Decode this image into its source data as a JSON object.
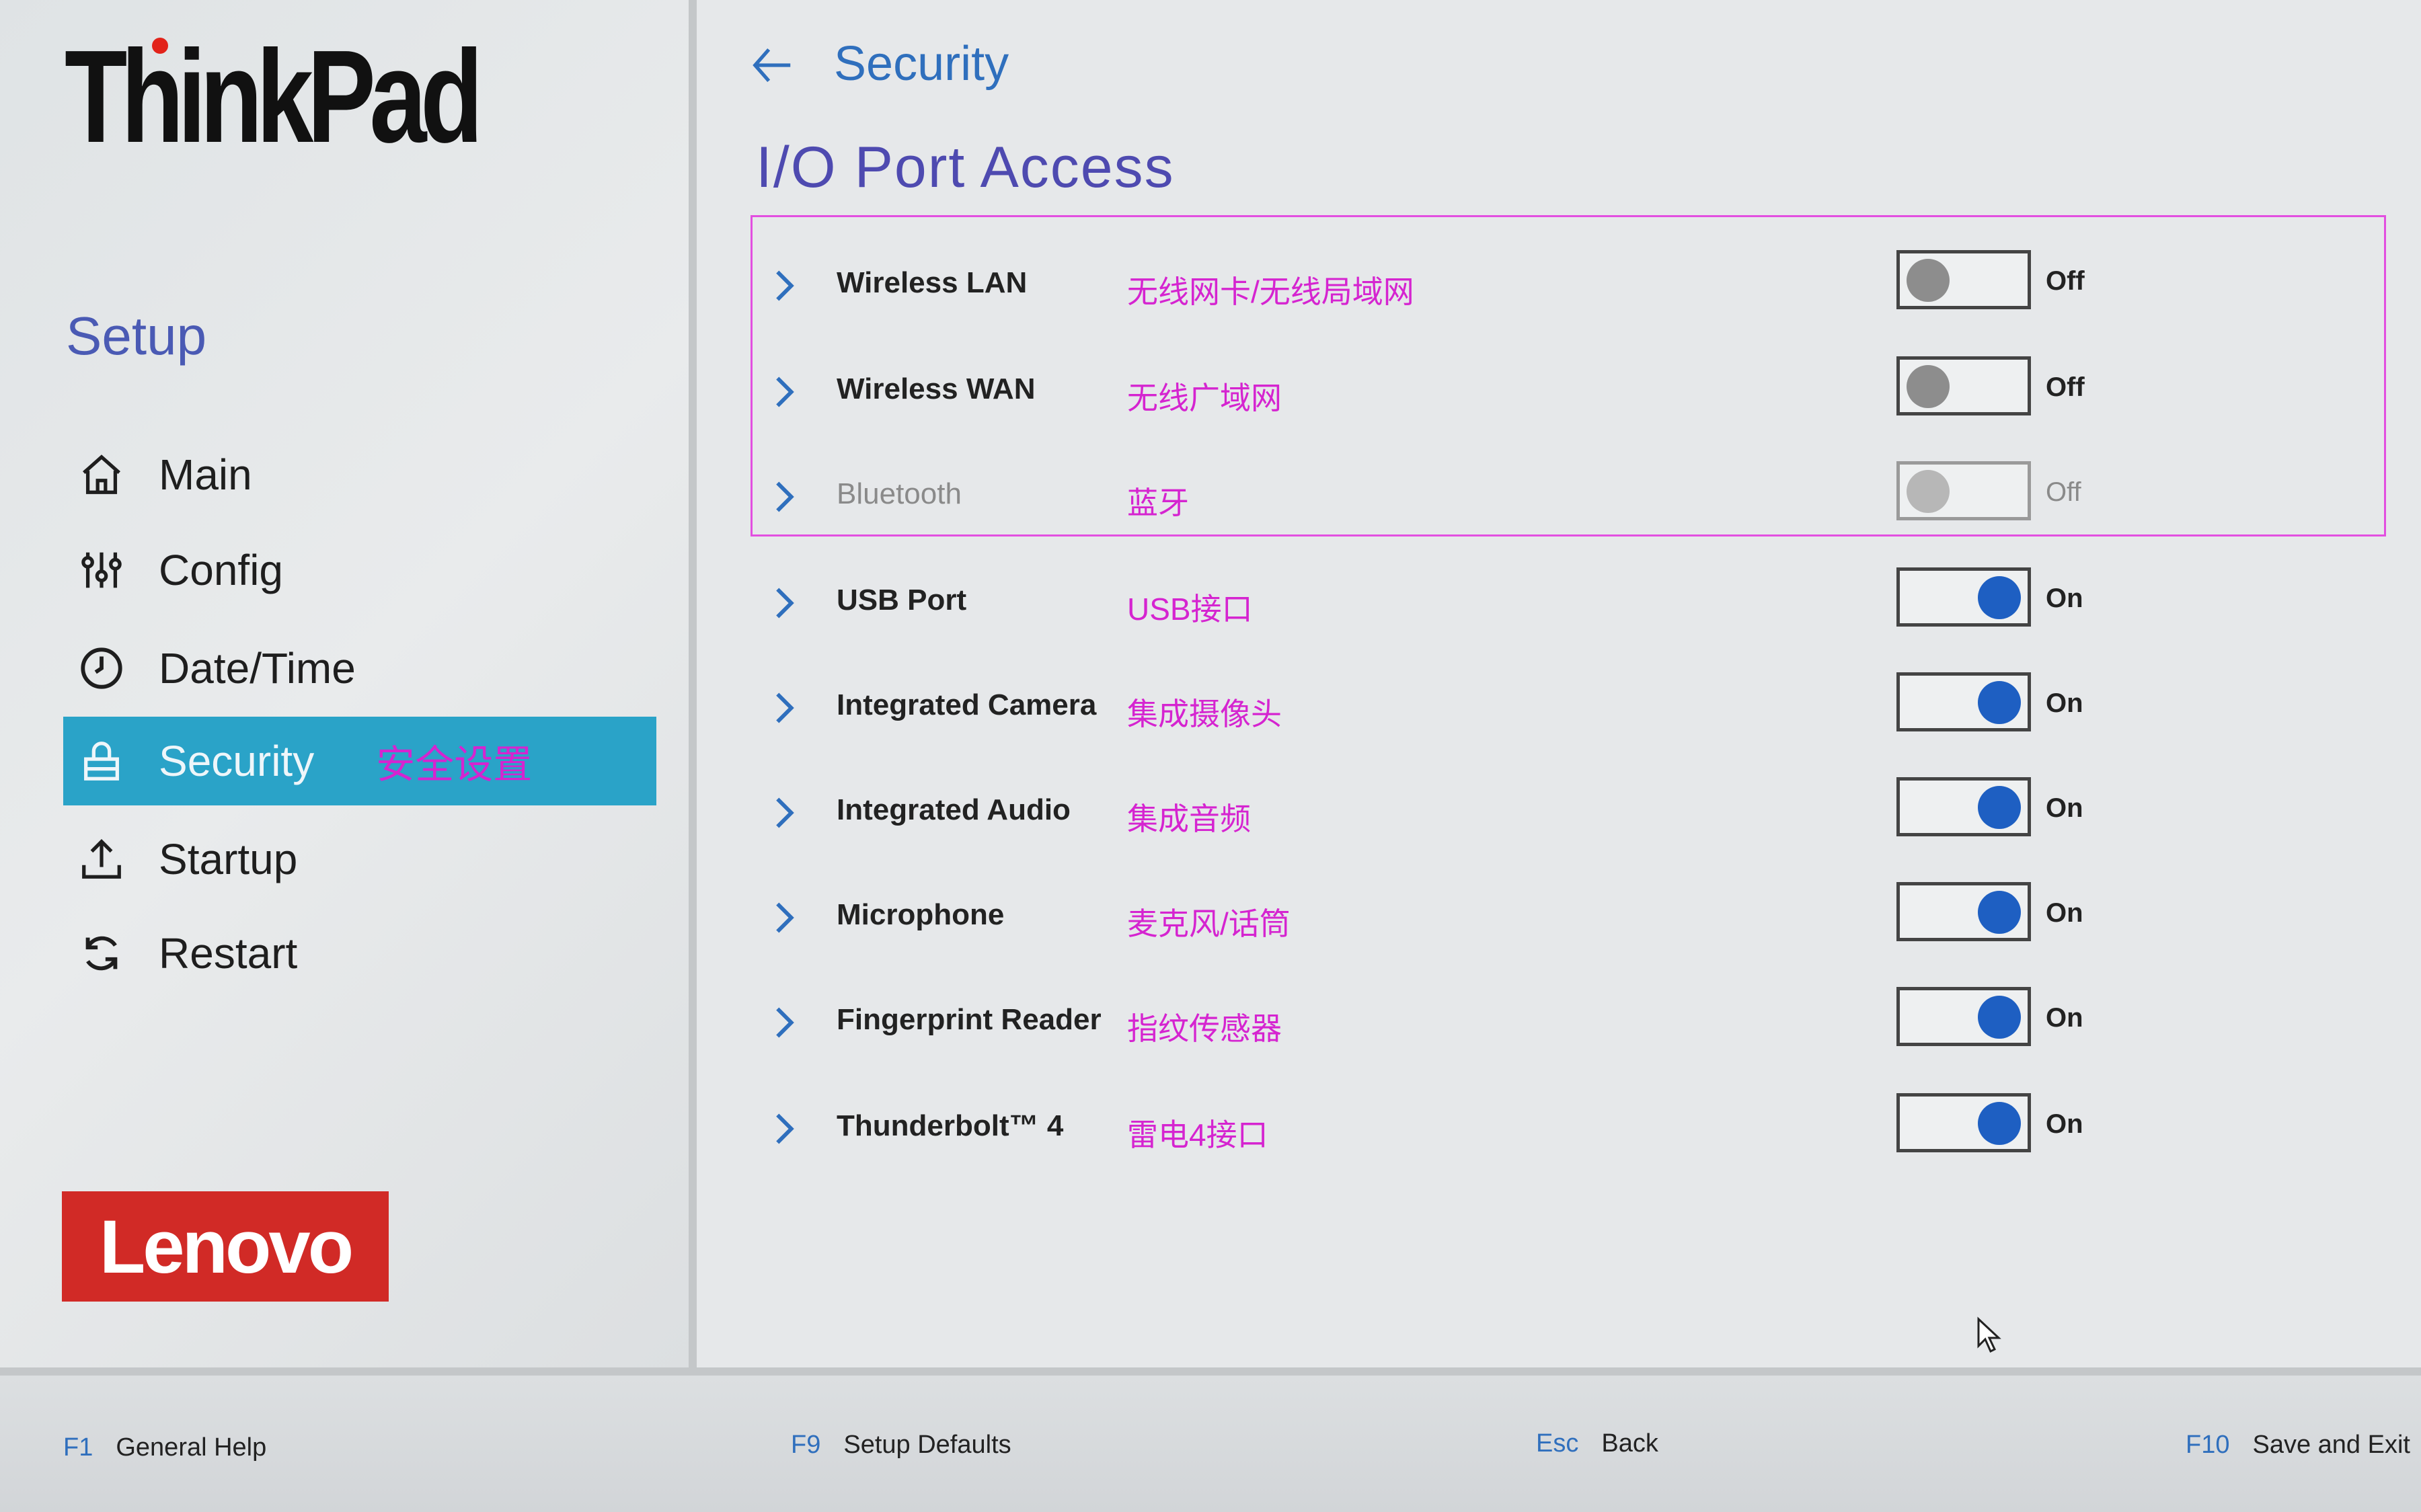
{
  "brand": {
    "product_logo": "ThinkPad",
    "vendor_logo": "Lenovo"
  },
  "sidebar": {
    "title": "Setup",
    "items": [
      {
        "label": "Main",
        "icon": "home-icon",
        "annotation": ""
      },
      {
        "label": "Config",
        "icon": "sliders-icon",
        "annotation": ""
      },
      {
        "label": "Date/Time",
        "icon": "clock-icon",
        "annotation": ""
      },
      {
        "label": "Security",
        "icon": "lock-icon",
        "annotation": "安全设置",
        "active": true
      },
      {
        "label": "Startup",
        "icon": "upload-icon",
        "annotation": ""
      },
      {
        "label": "Restart",
        "icon": "restart-icon",
        "annotation": ""
      }
    ]
  },
  "header": {
    "breadcrumb": "Security",
    "title": "I/O Port Access"
  },
  "ports": [
    {
      "name": "Wireless LAN",
      "annotation": "无线网卡/无线局域网",
      "state": "Off"
    },
    {
      "name": "Wireless WAN",
      "annotation": "无线广域网",
      "state": "Off"
    },
    {
      "name": "Bluetooth",
      "annotation": "蓝牙",
      "state": "Off",
      "disabled": true
    },
    {
      "name": "USB Port",
      "annotation": "USB接口",
      "state": "On"
    },
    {
      "name": "Integrated Camera",
      "annotation": "集成摄像头",
      "state": "On"
    },
    {
      "name": "Integrated Audio",
      "annotation": "集成音频",
      "state": "On"
    },
    {
      "name": "Microphone",
      "annotation": "麦克风/话筒",
      "state": "On"
    },
    {
      "name": "Fingerprint Reader",
      "annotation": "指纹传感器",
      "state": "On"
    },
    {
      "name": "Thunderbolt™ 4",
      "annotation": "雷电4接口",
      "state": "On"
    }
  ],
  "footer": [
    {
      "key": "F1",
      "label": "General Help"
    },
    {
      "key": "F9",
      "label": "Setup Defaults"
    },
    {
      "key": "Esc",
      "label": "Back"
    },
    {
      "key": "F10",
      "label": "Save and Exit"
    }
  ],
  "colors": {
    "accent": "#2aa3c8",
    "annotation": "#d524d0",
    "toggle_on": "#1e5fc2",
    "title": "#4e4ab0",
    "brand_red": "#d12a26"
  }
}
